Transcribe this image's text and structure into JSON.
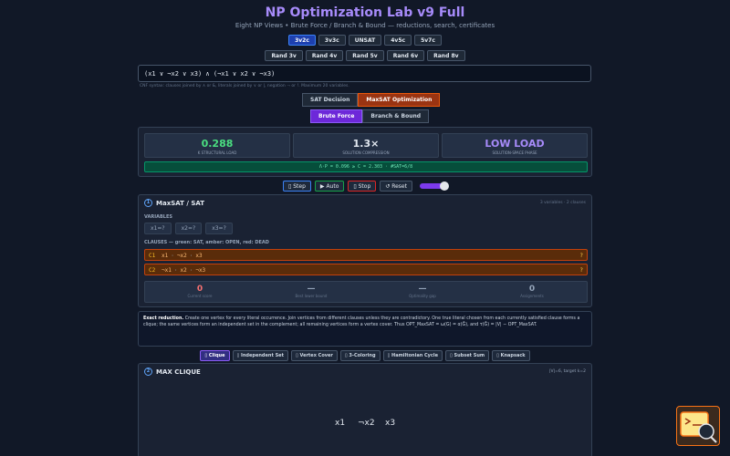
{
  "header": {
    "title": "NP Optimization Lab v9 Full",
    "subtitle": "Eight NP Views • Brute Force / Branch & Bound — reductions, search, certificates"
  },
  "presets": [
    "3v2c",
    "3v3c",
    "UNSAT",
    "4v5c",
    "5v7c"
  ],
  "random": [
    "Rand 3v",
    "Rand 4v",
    "Rand 5v",
    "Rand 6v",
    "Rand 8v"
  ],
  "formula": {
    "value": "(x1 ∨ ¬x2 ∨ x3) ∧ (¬x1 ∨ x2 ∨ ¬x3)",
    "hint": "CNF syntax: clauses joined by ∧ or &, literals joined by ∨ or |, negation ¬ or !. Maximum 20 variables."
  },
  "modes": {
    "decision": "SAT Decision",
    "optimization": "MaxSAT Optimization"
  },
  "methods": {
    "brute": "Brute Force",
    "bnb": "Branch & Bound"
  },
  "metrics": [
    {
      "value": "0.288",
      "label": "K STRUCTURAL LOAD",
      "color": "#4ade80"
    },
    {
      "value": "1.3×",
      "label": "SOLUTION COMPRESSION",
      "color": "#e2e8f0"
    },
    {
      "value": "LOW LOAD",
      "label": "SOLUTION-SPACE PHASE",
      "color": "#a78bfa"
    }
  ],
  "equation": "Λ·P = 0.096 ≥ C = 2.303 · #SAT=6/8",
  "controls": {
    "step": "Step",
    "auto": "Auto",
    "stop": "Stop",
    "reset": "Reset"
  },
  "maxsat": {
    "num": "1",
    "title": "MaxSAT / SAT",
    "meta": "3 variables · 2 clauses",
    "variables_label": "VARIABLES",
    "variables": [
      "x1=?",
      "x2=?",
      "x3=?"
    ],
    "clauses_label": "CLAUSES — green: SAT, amber: OPEN, red: DEAD",
    "clauses": [
      {
        "id": "C1",
        "lits": [
          "x1",
          "¬x2",
          "x3"
        ],
        "state": "?"
      },
      {
        "id": "C2",
        "lits": [
          "¬x1",
          "x2",
          "¬x3"
        ],
        "state": "?"
      }
    ],
    "stats": [
      {
        "value": "0",
        "label": "Current score",
        "color": "#f87171"
      },
      {
        "value": "—",
        "label": "Best lower bound",
        "color": "#94a3b8"
      },
      {
        "value": "—",
        "label": "Optimality gap",
        "color": "#94a3b8"
      },
      {
        "value": "0",
        "label": "Assignments",
        "color": "#94a3b8"
      }
    ]
  },
  "note": {
    "bold": "Exact reduction.",
    "text": " Create one vertex for every literal occurrence. Join vertices from different clauses unless they are contradictory. One true literal chosen from each currently satisfied clause forms a clique; the same vertices form an independent set in the complement; all remaining vertices form a vertex cover. Thus OPT_MaxSAT = ω(G) = α(Ḡ), and τ(Ḡ) = |V| − OPT_MaxSAT."
  },
  "views": [
    "Clique",
    "Independent Set",
    "Vertex Cover",
    "3-Coloring",
    "Hamiltonian Cycle",
    "Subset Sum",
    "Knapsack"
  ],
  "clique": {
    "num": "2",
    "title": "MAX CLIQUE",
    "meta": "|V|=6, target k=2",
    "nodes": [
      "x1",
      "¬x2",
      "x3"
    ]
  }
}
